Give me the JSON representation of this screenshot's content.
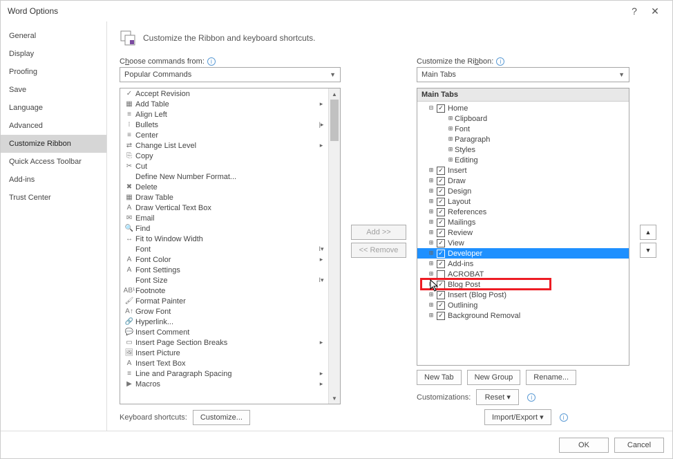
{
  "title": "Word Options",
  "sidebar": {
    "items": [
      {
        "label": "General"
      },
      {
        "label": "Display"
      },
      {
        "label": "Proofing"
      },
      {
        "label": "Save"
      },
      {
        "label": "Language"
      },
      {
        "label": "Advanced"
      },
      {
        "label": "Customize Ribbon"
      },
      {
        "label": "Quick Access Toolbar"
      },
      {
        "label": "Add-ins"
      },
      {
        "label": "Trust Center"
      }
    ],
    "selected_index": 6
  },
  "header": "Customize the Ribbon and keyboard shortcuts.",
  "left": {
    "label_pre": "C",
    "label_u": "h",
    "label_post": "oose commands from:",
    "dropdown": "Popular Commands",
    "commands": [
      {
        "i": "✓",
        "t": "Accept Revision"
      },
      {
        "i": "▦",
        "t": "Add Table",
        "s": "▸"
      },
      {
        "i": "≡",
        "t": "Align Left"
      },
      {
        "i": "⁝",
        "t": "Bullets",
        "s": "|▸"
      },
      {
        "i": "≡",
        "t": "Center"
      },
      {
        "i": "⇄",
        "t": "Change List Level",
        "s": "▸"
      },
      {
        "i": "⎘",
        "t": "Copy"
      },
      {
        "i": "✂",
        "t": "Cut"
      },
      {
        "i": "",
        "t": "Define New Number Format..."
      },
      {
        "i": "✖",
        "t": "Delete"
      },
      {
        "i": "▦",
        "t": "Draw Table"
      },
      {
        "i": "A",
        "t": "Draw Vertical Text Box"
      },
      {
        "i": "✉",
        "t": "Email"
      },
      {
        "i": "🔍",
        "t": "Find"
      },
      {
        "i": "↔",
        "t": "Fit to Window Width"
      },
      {
        "i": "",
        "t": "Font",
        "s": "I▾"
      },
      {
        "i": "A",
        "t": "Font Color",
        "s": "▸"
      },
      {
        "i": "A",
        "t": "Font Settings"
      },
      {
        "i": "",
        "t": "Font Size",
        "s": "I▾"
      },
      {
        "i": "AB¹",
        "t": "Footnote"
      },
      {
        "i": "🖌",
        "t": "Format Painter"
      },
      {
        "i": "A↑",
        "t": "Grow Font"
      },
      {
        "i": "🔗",
        "t": "Hyperlink..."
      },
      {
        "i": "💬",
        "t": "Insert Comment"
      },
      {
        "i": "▭",
        "t": "Insert Page  Section Breaks",
        "s": "▸"
      },
      {
        "i": "🖼",
        "t": "Insert Picture"
      },
      {
        "i": "A",
        "t": "Insert Text Box"
      },
      {
        "i": "≡",
        "t": "Line and Paragraph Spacing",
        "s": "▸"
      },
      {
        "i": "▶",
        "t": "Macros",
        "s": "▸"
      }
    ],
    "kb_label": "Keyboard shortcuts:",
    "kb_button": "Customize..."
  },
  "mid": {
    "add": "Add >>",
    "remove": "<< Remove"
  },
  "right": {
    "label_pre": "Customize the Ri",
    "label_u": "b",
    "label_post": "bon:",
    "dropdown": "Main Tabs",
    "tree_header": "Main Tabs",
    "home_label": "Home",
    "home_children": [
      "Clipboard",
      "Font",
      "Paragraph",
      "Styles",
      "Editing"
    ],
    "tabs": [
      {
        "l": "Insert",
        "c": true
      },
      {
        "l": "Draw",
        "c": true
      },
      {
        "l": "Design",
        "c": true
      },
      {
        "l": "Layout",
        "c": true
      },
      {
        "l": "References",
        "c": true
      },
      {
        "l": "Mailings",
        "c": true
      },
      {
        "l": "Review",
        "c": true
      },
      {
        "l": "View",
        "c": true
      }
    ],
    "developer": {
      "l": "Developer",
      "c": true
    },
    "tabs2": [
      {
        "l": "Add-ins",
        "c": true
      },
      {
        "l": "ACROBAT",
        "c": false
      },
      {
        "l": "Blog Post",
        "c": true
      },
      {
        "l": "Insert (Blog Post)",
        "c": true
      },
      {
        "l": "Outlining",
        "c": true
      },
      {
        "l": "Background Removal",
        "c": true
      }
    ],
    "newtab": "New Tab",
    "newgroup": "New Group",
    "rename": "Rename...",
    "customizations_label": "Customizations:",
    "reset": "Reset",
    "impexp": "Import/Export"
  },
  "footer": {
    "ok": "OK",
    "cancel": "Cancel"
  }
}
